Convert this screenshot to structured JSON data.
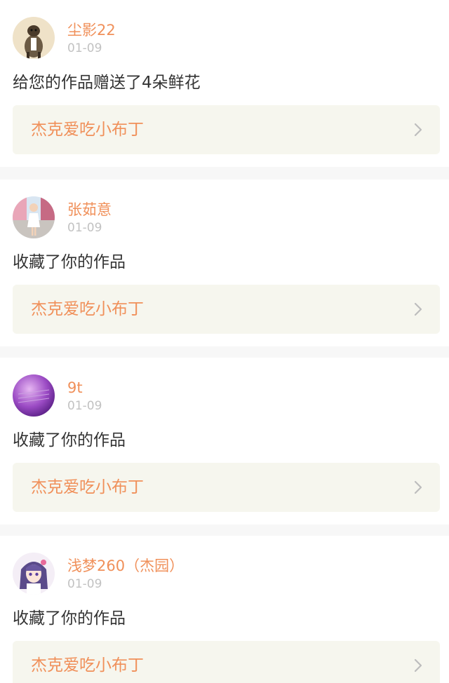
{
  "colors": {
    "accent": "#f0905a",
    "muted_text": "#c2c2c2",
    "body_text": "#333333",
    "link_background": "#f6f6ee",
    "separator": "#f7f7f7"
  },
  "notifications": [
    {
      "user": "尘影22",
      "date": "01-09",
      "action": "给您的作品赠送了4朵鲜花",
      "work_title": "杰克爱吃小布丁",
      "avatar_icon": "dog-photo-avatar"
    },
    {
      "user": "张茹意",
      "date": "01-09",
      "action": "收藏了你的作品",
      "work_title": "杰克爱吃小布丁",
      "avatar_icon": "girl-photo-avatar"
    },
    {
      "user": "9t",
      "date": "01-09",
      "action": "收藏了你的作品",
      "work_title": "杰克爱吃小布丁",
      "avatar_icon": "purple-photo-avatar"
    },
    {
      "user": "浅梦260（杰园）",
      "date": "01-09",
      "action": "收藏了你的作品",
      "work_title": "杰克爱吃小布丁",
      "avatar_icon": "anime-girl-avatar"
    }
  ]
}
